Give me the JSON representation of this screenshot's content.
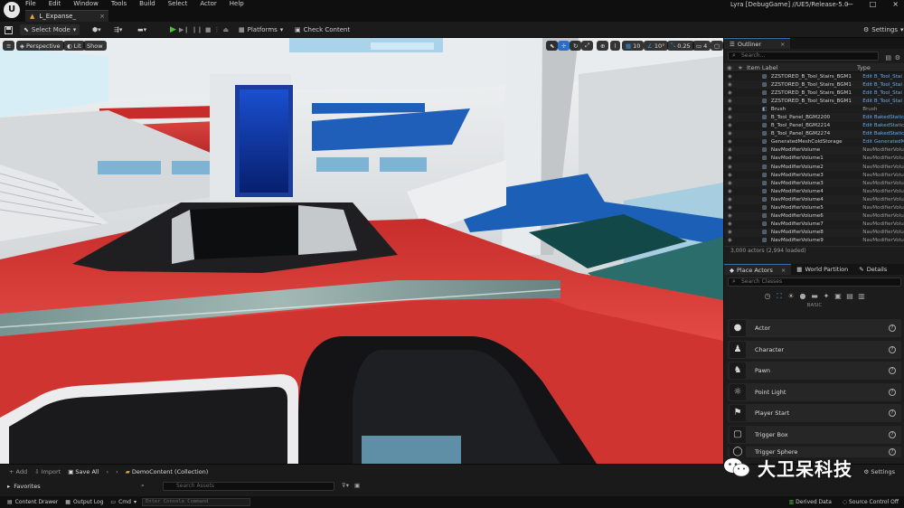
{
  "menu": [
    "File",
    "Edit",
    "Window",
    "Tools",
    "Build",
    "Select",
    "Actor",
    "Help"
  ],
  "level_tab": "L_Expanse_",
  "project": "Lyra [DebugGame] //UE5/Release-5.0",
  "toolbar": {
    "select_mode": "Select Mode",
    "platforms": "Platforms",
    "check_content": "Check Content",
    "settings": "Settings"
  },
  "viewport": {
    "perspective": "Perspective",
    "lit": "Lit",
    "show": "Show",
    "grid_snap": "10",
    "rot_snap": "10°",
    "scale_snap": "0.25",
    "camera_speed": "4"
  },
  "outliner": {
    "tab": "Outliner",
    "search_placeholder": "Search...",
    "col_label": "Item Label",
    "col_type": "Type",
    "rows": [
      {
        "label": "ZZSTORED_B_Tool_Stairs_BGM1",
        "type": "Edit B_Tool_Stai",
        "link": true
      },
      {
        "label": "ZZSTORED_B_Tool_Stairs_BGM1",
        "type": "Edit B_Tool_Stai",
        "link": true
      },
      {
        "label": "ZZSTORED_B_Tool_Stairs_BGM1",
        "type": "Edit B_Tool_Stai",
        "link": true
      },
      {
        "label": "ZZSTORED_B_Tool_Stairs_BGM1",
        "type": "Edit B_Tool_Stai",
        "link": true
      },
      {
        "label": "Brush",
        "type": "Brush",
        "link": false
      },
      {
        "label": "B_Tool_Panel_BGM2200",
        "type": "Edit BakedStatic",
        "link": true
      },
      {
        "label": "B_Tool_Panel_BGM2214",
        "type": "Edit BakedStatic",
        "link": true
      },
      {
        "label": "B_Tool_Panel_BGM2274",
        "type": "Edit BakedStatic",
        "link": true
      },
      {
        "label": "GeneratedMeshColdStorage",
        "type": "Edit GeneratedM",
        "link": true
      },
      {
        "label": "NavModifierVolume",
        "type": "NavModifierVolu",
        "link": false
      },
      {
        "label": "NavModifierVolume1",
        "type": "NavModifierVolu",
        "link": false
      },
      {
        "label": "NavModifierVolume2",
        "type": "NavModifierVolu",
        "link": false
      },
      {
        "label": "NavModifierVolume3",
        "type": "NavModifierVolu",
        "link": false
      },
      {
        "label": "NavModifierVolume3",
        "type": "NavModifierVolu",
        "link": false
      },
      {
        "label": "NavModifierVolume4",
        "type": "NavModifierVolu",
        "link": false
      },
      {
        "label": "NavModifierVolume4",
        "type": "NavModifierVolu",
        "link": false
      },
      {
        "label": "NavModifierVolume5",
        "type": "NavModifierVolu",
        "link": false
      },
      {
        "label": "NavModifierVolume6",
        "type": "NavModifierVolu",
        "link": false
      },
      {
        "label": "NavModifierVolume7",
        "type": "NavModifierVolu",
        "link": false
      },
      {
        "label": "NavModifierVolume8",
        "type": "NavModifierVolu",
        "link": false
      },
      {
        "label": "NavModifierVolume9",
        "type": "NavModifierVolu",
        "link": false
      }
    ],
    "footer": "3,000 actors (2,994 loaded)"
  },
  "place_panel": {
    "tabs": [
      "Place Actors",
      "World Partition",
      "Details"
    ],
    "search_placeholder": "Search Classes",
    "category": "BASIC",
    "actors": [
      "Actor",
      "Character",
      "Pawn",
      "Point Light",
      "Player Start",
      "Trigger Box",
      "Trigger Sphere"
    ]
  },
  "content_browser": {
    "add": "+ Add",
    "import": "Import",
    "save_all": "Save All",
    "path": "DemoContent (Collection)",
    "favorites": "Favorites",
    "search_placeholder": "Search Assets",
    "settings": "Settings"
  },
  "statusbar": {
    "content_drawer": "Content Drawer",
    "output_log": "Output Log",
    "cmd": "Cmd",
    "console_placeholder": "Enter Console Command",
    "derived_data": "Derived Data",
    "source_control": "Source Control Off"
  },
  "watermark": "大卫呆科技"
}
